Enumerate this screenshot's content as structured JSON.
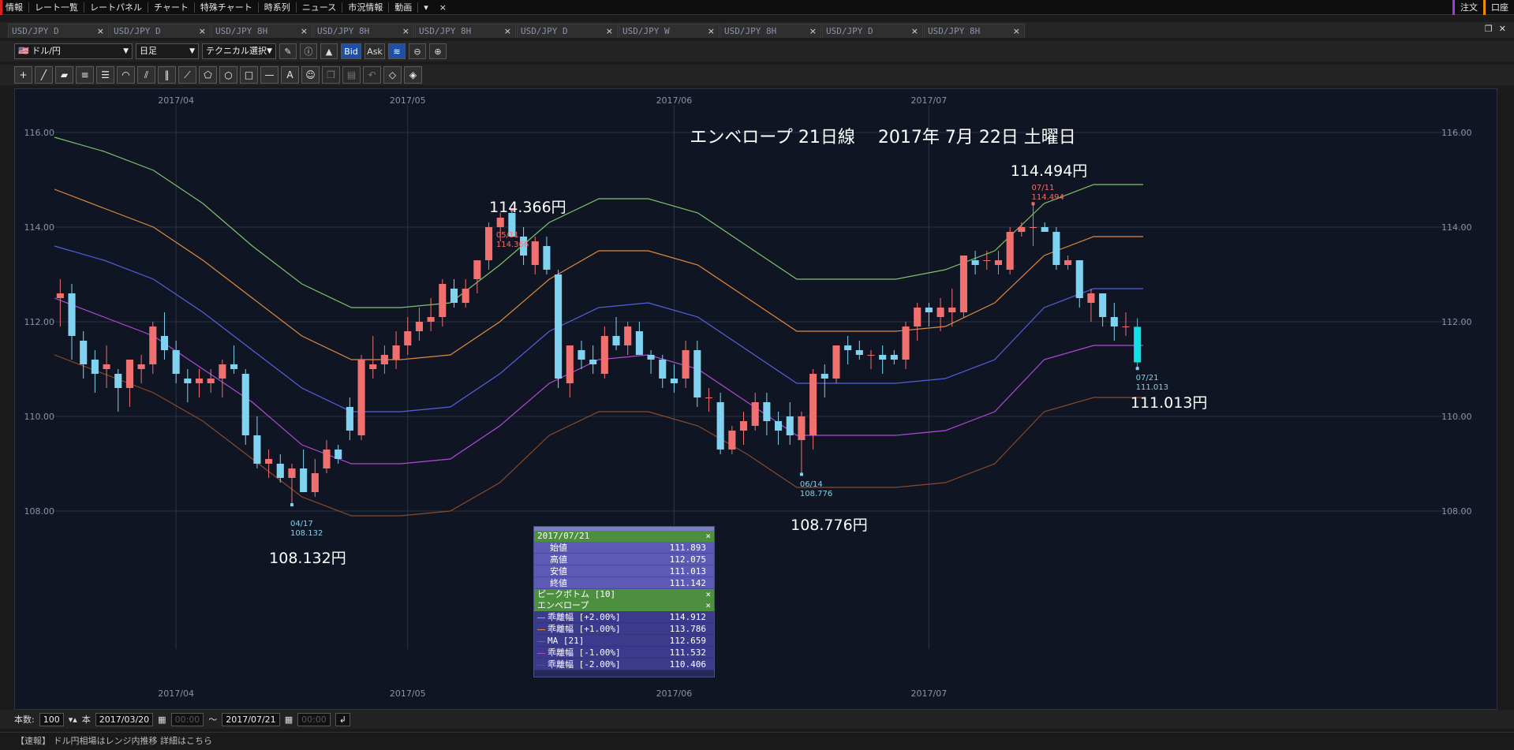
{
  "menu": {
    "items": [
      "情報",
      "レート一覧",
      "レートパネル",
      "チャート",
      "特殊チャート",
      "時系列",
      "ニュース",
      "市況情報",
      "動画",
      "▾",
      "×"
    ],
    "right": [
      "注文",
      "口座"
    ]
  },
  "tabs": [
    {
      "label": "USD/JPY D",
      "active": true
    },
    {
      "label": "USD/JPY D",
      "active": false
    },
    {
      "label": "USD/JPY 8H",
      "active": false
    },
    {
      "label": "USD/JPY 8H",
      "active": false
    },
    {
      "label": "USD/JPY 8H",
      "active": false
    },
    {
      "label": "USD/JPY D",
      "active": false
    },
    {
      "label": "USD/JPY W",
      "active": false
    },
    {
      "label": "USD/JPY 8H",
      "active": false
    },
    {
      "label": "USD/JPY D",
      "active": false
    },
    {
      "label": "USD/JPY 8H",
      "active": false
    }
  ],
  "toolbar": {
    "pair": "ドル/円",
    "timeframe": "日足",
    "technical": "テクニカル選択",
    "bid": "Bid",
    "ask": "Ask"
  },
  "footer": {
    "count_label": "本数:",
    "count_value": "100",
    "count_unit": "本",
    "start_date": "2017/03/20",
    "start_time": "00:00",
    "tilde": "〜",
    "end_date": "2017/07/21",
    "end_time": "00:00"
  },
  "status": {
    "text": "【速報】 ドル円相場はレンジ内推移 詳細はこちら"
  },
  "annotations": {
    "title": "エンベロープ 21日線　 2017年 7月 22日 土曜日",
    "high1_price": "114.366円",
    "high1_marker_date": "05/11",
    "high1_marker_price": "114.366",
    "low1_price": "108.132円",
    "low1_marker_date": "04/17",
    "low1_marker_price": "108.132",
    "low2_price": "108.776円",
    "low2_marker_date": "06/14",
    "low2_marker_price": "108.776",
    "high2_price": "114.494円",
    "high2_marker_date": "07/11",
    "high2_marker_price": "114.494",
    "last_price": "111.013円",
    "last_marker_date": "07/21",
    "last_marker_price": "111.013"
  },
  "info_panel": {
    "date": "2017/07/21",
    "rows": [
      {
        "label": "始値",
        "value": "111.893"
      },
      {
        "label": "高値",
        "value": "112.075"
      },
      {
        "label": "安値",
        "value": "111.013"
      },
      {
        "label": "終値",
        "value": "111.142"
      }
    ],
    "peak_bottom": "ピークボトム [10]",
    "envelope": "エンベロープ",
    "env_rows": [
      {
        "label": "乖離幅 [+2.00%]",
        "value": "114.912",
        "color": "#7dc36b"
      },
      {
        "label": "乖離幅 [+1.00%]",
        "value": "113.786",
        "color": "#e08a3c"
      },
      {
        "label": "MA [21]",
        "value": "112.659",
        "color": "#5560e0"
      },
      {
        "label": "乖離幅 [-1.00%]",
        "value": "111.532",
        "color": "#b04ad8"
      },
      {
        "label": "乖離幅 [-2.00%]",
        "value": "110.406",
        "color": "#8a4a2a"
      }
    ],
    "close": "×"
  },
  "chart_data": {
    "type": "candlestick",
    "title": "エンベロープ 21日線　 2017年 7月 22日 土曜日",
    "y_ticks": [
      "116.00",
      "114.00",
      "112.00",
      "110.00",
      "108.00"
    ],
    "x_ticks": [
      "2017/04",
      "2017/05",
      "2017/06",
      "2017/07"
    ],
    "ylim": [
      107.0,
      117.0
    ],
    "colors": {
      "up": "#f07070",
      "down": "#7fd3f0",
      "last": "#10e0e8",
      "grid": "#2a3446"
    },
    "candles": [
      [
        112.5,
        112.9,
        111.9,
        112.6
      ],
      [
        112.6,
        112.8,
        111.2,
        111.7
      ],
      [
        111.6,
        111.8,
        110.8,
        111.1
      ],
      [
        111.2,
        111.4,
        110.5,
        110.9
      ],
      [
        111.0,
        111.5,
        110.6,
        111.1
      ],
      [
        110.9,
        111.0,
        110.1,
        110.6
      ],
      [
        110.6,
        111.2,
        110.2,
        111.2
      ],
      [
        111.0,
        111.3,
        110.7,
        111.1
      ],
      [
        111.1,
        112.0,
        110.9,
        111.9
      ],
      [
        111.7,
        112.2,
        111.2,
        111.4
      ],
      [
        111.4,
        111.6,
        110.7,
        110.9
      ],
      [
        110.8,
        111.0,
        110.3,
        110.7
      ],
      [
        110.7,
        111.0,
        110.4,
        110.8
      ],
      [
        110.7,
        111.0,
        110.5,
        110.8
      ],
      [
        110.8,
        111.2,
        110.4,
        111.1
      ],
      [
        111.1,
        111.5,
        110.9,
        111.0
      ],
      [
        110.9,
        111.0,
        109.4,
        109.6
      ],
      [
        109.6,
        110.0,
        108.9,
        109.0
      ],
      [
        109.0,
        109.3,
        108.7,
        109.1
      ],
      [
        109.0,
        109.2,
        108.6,
        108.7
      ],
      [
        108.7,
        109.0,
        108.132,
        108.9
      ],
      [
        108.9,
        109.3,
        108.4,
        108.4
      ],
      [
        108.4,
        109.1,
        108.3,
        108.8
      ],
      [
        108.9,
        109.5,
        108.8,
        109.3
      ],
      [
        109.3,
        109.4,
        109.0,
        109.1
      ],
      [
        110.2,
        110.4,
        109.5,
        109.7
      ],
      [
        109.6,
        111.3,
        109.5,
        111.2
      ],
      [
        111.0,
        111.7,
        110.8,
        111.1
      ],
      [
        111.1,
        111.5,
        110.9,
        111.3
      ],
      [
        111.2,
        111.8,
        111.0,
        111.5
      ],
      [
        111.5,
        112.1,
        111.3,
        111.8
      ],
      [
        111.8,
        112.3,
        111.6,
        112.0
      ],
      [
        112.0,
        112.5,
        111.8,
        112.1
      ],
      [
        112.1,
        112.9,
        111.9,
        112.8
      ],
      [
        112.7,
        112.9,
        112.3,
        112.4
      ],
      [
        112.4,
        112.9,
        112.3,
        112.7
      ],
      [
        112.9,
        113.3,
        112.6,
        113.3
      ],
      [
        113.3,
        114.1,
        113.1,
        114.0
      ],
      [
        114.0,
        114.3,
        113.7,
        114.2
      ],
      [
        114.3,
        114.366,
        113.8,
        113.8
      ],
      [
        113.8,
        114.0,
        113.2,
        113.4
      ],
      [
        113.2,
        113.8,
        113.0,
        113.7
      ],
      [
        113.6,
        113.8,
        113.0,
        113.1
      ],
      [
        113.0,
        113.1,
        110.6,
        110.8
      ],
      [
        110.7,
        111.5,
        110.4,
        111.5
      ],
      [
        111.4,
        111.6,
        111.0,
        111.2
      ],
      [
        111.2,
        111.5,
        110.9,
        111.1
      ],
      [
        110.9,
        111.9,
        110.8,
        111.7
      ],
      [
        111.7,
        112.1,
        111.4,
        111.5
      ],
      [
        111.5,
        112.0,
        111.3,
        111.9
      ],
      [
        111.8,
        112.0,
        111.3,
        111.3
      ],
      [
        111.3,
        111.4,
        110.9,
        111.2
      ],
      [
        111.2,
        111.3,
        110.6,
        110.8
      ],
      [
        110.8,
        111.1,
        110.5,
        110.7
      ],
      [
        110.8,
        111.6,
        110.6,
        111.4
      ],
      [
        111.4,
        111.6,
        110.2,
        110.4
      ],
      [
        110.4,
        110.6,
        110.1,
        110.4
      ],
      [
        110.3,
        110.5,
        109.2,
        109.3
      ],
      [
        109.3,
        109.8,
        109.2,
        109.7
      ],
      [
        109.7,
        110.1,
        109.4,
        109.9
      ],
      [
        109.8,
        110.5,
        109.7,
        110.3
      ],
      [
        110.3,
        110.5,
        109.6,
        109.9
      ],
      [
        109.9,
        110.1,
        109.4,
        109.7
      ],
      [
        110.0,
        110.3,
        109.4,
        109.6
      ],
      [
        109.5,
        110.1,
        108.776,
        110.0
      ],
      [
        109.6,
        111.0,
        109.3,
        110.9
      ],
      [
        110.9,
        111.1,
        110.4,
        110.8
      ],
      [
        110.8,
        111.5,
        110.7,
        111.5
      ],
      [
        111.5,
        111.7,
        111.1,
        111.4
      ],
      [
        111.4,
        111.6,
        111.2,
        111.3
      ],
      [
        111.3,
        111.4,
        111.0,
        111.3
      ],
      [
        111.3,
        111.5,
        110.9,
        111.2
      ],
      [
        111.3,
        111.4,
        111.1,
        111.2
      ],
      [
        111.2,
        112.0,
        111.0,
        111.9
      ],
      [
        111.9,
        112.4,
        111.6,
        112.3
      ],
      [
        112.3,
        112.4,
        111.9,
        112.2
      ],
      [
        112.1,
        112.5,
        111.8,
        112.3
      ],
      [
        112.2,
        112.7,
        111.9,
        112.3
      ],
      [
        112.2,
        113.4,
        112.1,
        113.4
      ],
      [
        113.3,
        113.5,
        113.0,
        113.2
      ],
      [
        113.3,
        113.5,
        113.1,
        113.3
      ],
      [
        113.2,
        113.5,
        113.0,
        113.3
      ],
      [
        113.1,
        114.0,
        113.0,
        113.9
      ],
      [
        113.9,
        114.1,
        113.8,
        114.0
      ],
      [
        114.0,
        114.494,
        113.6,
        114.0
      ],
      [
        114.0,
        114.1,
        113.9,
        113.9
      ],
      [
        113.9,
        114.0,
        113.1,
        113.2
      ],
      [
        113.2,
        113.4,
        113.1,
        113.3
      ],
      [
        113.3,
        113.3,
        112.3,
        112.5
      ],
      [
        112.4,
        112.7,
        112.0,
        112.6
      ],
      [
        112.6,
        112.6,
        111.9,
        112.1
      ],
      [
        112.1,
        112.4,
        111.6,
        111.9
      ],
      [
        111.9,
        112.2,
        111.7,
        111.9
      ],
      [
        111.893,
        112.075,
        111.013,
        111.142
      ]
    ],
    "envelope": {
      "plus2": [
        115.9,
        115.6,
        115.2,
        114.5,
        113.6,
        112.8,
        112.3,
        112.3,
        112.4,
        113.2,
        114.1,
        114.6,
        114.6,
        114.3,
        113.6,
        112.9,
        112.9,
        112.9,
        113.1,
        113.5,
        114.5,
        114.9,
        114.9
      ],
      "plus1": [
        114.8,
        114.4,
        114.0,
        113.3,
        112.5,
        111.7,
        111.2,
        111.2,
        111.3,
        112.0,
        112.9,
        113.5,
        113.5,
        113.2,
        112.5,
        111.8,
        111.8,
        111.8,
        111.9,
        112.4,
        113.4,
        113.8,
        113.8
      ],
      "ma": [
        113.6,
        113.3,
        112.9,
        112.2,
        111.4,
        110.6,
        110.1,
        110.1,
        110.2,
        110.9,
        111.8,
        112.3,
        112.4,
        112.1,
        111.4,
        110.7,
        110.7,
        110.7,
        110.8,
        111.2,
        112.3,
        112.7,
        112.7
      ],
      "minus1": [
        112.5,
        112.1,
        111.7,
        111.0,
        110.3,
        109.4,
        109.0,
        109.0,
        109.1,
        109.8,
        110.7,
        111.2,
        111.3,
        111.0,
        110.3,
        109.6,
        109.6,
        109.6,
        109.7,
        110.1,
        111.2,
        111.5,
        111.5
      ],
      "minus2": [
        111.3,
        110.9,
        110.5,
        109.9,
        109.1,
        108.3,
        107.9,
        107.9,
        108.0,
        108.6,
        109.6,
        110.1,
        110.1,
        109.8,
        109.2,
        108.5,
        108.5,
        108.5,
        108.6,
        109.0,
        110.1,
        110.4,
        110.4
      ]
    },
    "envelope_colors": {
      "plus2": "#7dc36b",
      "plus1": "#e08a3c",
      "ma": "#5560e0",
      "minus1": "#b04ad8",
      "minus2": "#8a4a2a"
    }
  }
}
